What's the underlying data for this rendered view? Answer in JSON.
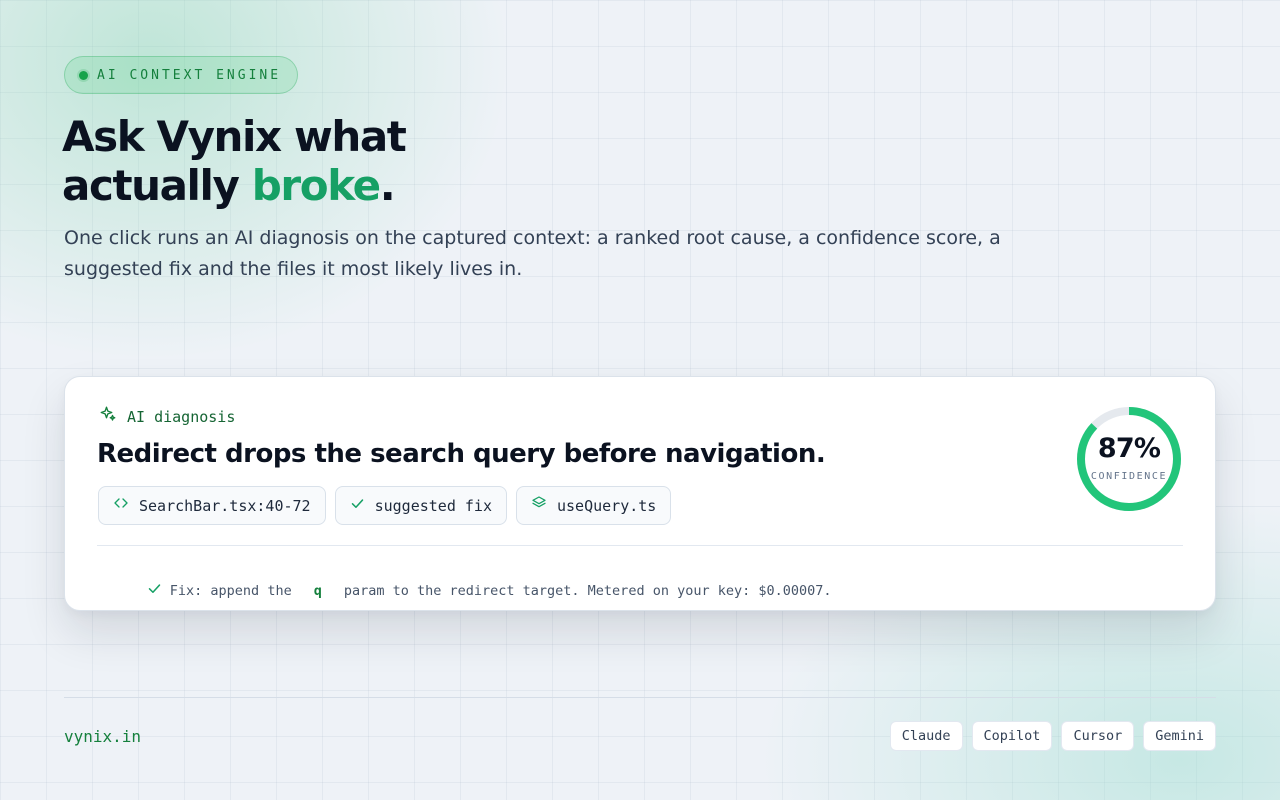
{
  "eyebrow": {
    "label": "AI CONTEXT ENGINE"
  },
  "hero": {
    "title_line1": "Ask Vynix what",
    "title_line2_prefix": "actually ",
    "title_accent": "broke",
    "title_suffix": ".",
    "subtitle": "One click runs an AI diagnosis on the captured context: a ranked root cause, a confidence score, a suggested fix and the files it most likely lives in."
  },
  "card": {
    "label": "AI diagnosis",
    "title": "Redirect drops the search query before navigation.",
    "chips": [
      {
        "label": "SearchBar.tsx:40-72",
        "icon": "code-icon"
      },
      {
        "label": "suggested fix",
        "icon": "check-icon"
      },
      {
        "label": "useQuery.ts",
        "icon": "layers-icon"
      }
    ],
    "fix": {
      "prefix": "Fix: append the",
      "code": "q",
      "suffix": "param to the redirect target. Metered on your key: $0.00007."
    },
    "confidence": {
      "value_text": "87%",
      "value": 0.87,
      "label": "CONFIDENCE"
    }
  },
  "footer": {
    "site": "vynix.in",
    "tools": [
      "Claude",
      "Copilot",
      "Cursor",
      "Gemini"
    ]
  },
  "colors": {
    "accent": "#16a065",
    "gauge_fill": "#22c57a",
    "gauge_track": "#e5e9ee"
  }
}
